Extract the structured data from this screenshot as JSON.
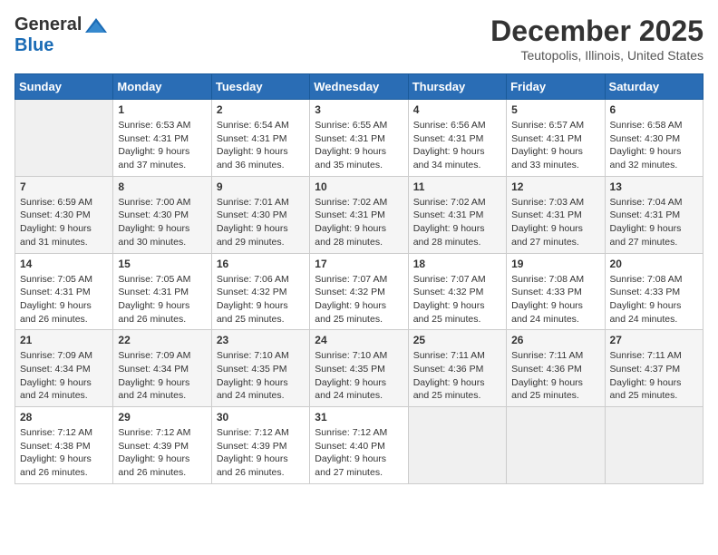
{
  "header": {
    "logo_general": "General",
    "logo_blue": "Blue",
    "month_title": "December 2025",
    "location": "Teutopolis, Illinois, United States"
  },
  "days_of_week": [
    "Sunday",
    "Monday",
    "Tuesday",
    "Wednesday",
    "Thursday",
    "Friday",
    "Saturday"
  ],
  "weeks": [
    [
      {
        "day": "",
        "sunrise": "",
        "sunset": "",
        "daylight": ""
      },
      {
        "day": "1",
        "sunrise": "Sunrise: 6:53 AM",
        "sunset": "Sunset: 4:31 PM",
        "daylight": "Daylight: 9 hours and 37 minutes."
      },
      {
        "day": "2",
        "sunrise": "Sunrise: 6:54 AM",
        "sunset": "Sunset: 4:31 PM",
        "daylight": "Daylight: 9 hours and 36 minutes."
      },
      {
        "day": "3",
        "sunrise": "Sunrise: 6:55 AM",
        "sunset": "Sunset: 4:31 PM",
        "daylight": "Daylight: 9 hours and 35 minutes."
      },
      {
        "day": "4",
        "sunrise": "Sunrise: 6:56 AM",
        "sunset": "Sunset: 4:31 PM",
        "daylight": "Daylight: 9 hours and 34 minutes."
      },
      {
        "day": "5",
        "sunrise": "Sunrise: 6:57 AM",
        "sunset": "Sunset: 4:31 PM",
        "daylight": "Daylight: 9 hours and 33 minutes."
      },
      {
        "day": "6",
        "sunrise": "Sunrise: 6:58 AM",
        "sunset": "Sunset: 4:30 PM",
        "daylight": "Daylight: 9 hours and 32 minutes."
      }
    ],
    [
      {
        "day": "7",
        "sunrise": "Sunrise: 6:59 AM",
        "sunset": "Sunset: 4:30 PM",
        "daylight": "Daylight: 9 hours and 31 minutes."
      },
      {
        "day": "8",
        "sunrise": "Sunrise: 7:00 AM",
        "sunset": "Sunset: 4:30 PM",
        "daylight": "Daylight: 9 hours and 30 minutes."
      },
      {
        "day": "9",
        "sunrise": "Sunrise: 7:01 AM",
        "sunset": "Sunset: 4:30 PM",
        "daylight": "Daylight: 9 hours and 29 minutes."
      },
      {
        "day": "10",
        "sunrise": "Sunrise: 7:02 AM",
        "sunset": "Sunset: 4:31 PM",
        "daylight": "Daylight: 9 hours and 28 minutes."
      },
      {
        "day": "11",
        "sunrise": "Sunrise: 7:02 AM",
        "sunset": "Sunset: 4:31 PM",
        "daylight": "Daylight: 9 hours and 28 minutes."
      },
      {
        "day": "12",
        "sunrise": "Sunrise: 7:03 AM",
        "sunset": "Sunset: 4:31 PM",
        "daylight": "Daylight: 9 hours and 27 minutes."
      },
      {
        "day": "13",
        "sunrise": "Sunrise: 7:04 AM",
        "sunset": "Sunset: 4:31 PM",
        "daylight": "Daylight: 9 hours and 27 minutes."
      }
    ],
    [
      {
        "day": "14",
        "sunrise": "Sunrise: 7:05 AM",
        "sunset": "Sunset: 4:31 PM",
        "daylight": "Daylight: 9 hours and 26 minutes."
      },
      {
        "day": "15",
        "sunrise": "Sunrise: 7:05 AM",
        "sunset": "Sunset: 4:31 PM",
        "daylight": "Daylight: 9 hours and 26 minutes."
      },
      {
        "day": "16",
        "sunrise": "Sunrise: 7:06 AM",
        "sunset": "Sunset: 4:32 PM",
        "daylight": "Daylight: 9 hours and 25 minutes."
      },
      {
        "day": "17",
        "sunrise": "Sunrise: 7:07 AM",
        "sunset": "Sunset: 4:32 PM",
        "daylight": "Daylight: 9 hours and 25 minutes."
      },
      {
        "day": "18",
        "sunrise": "Sunrise: 7:07 AM",
        "sunset": "Sunset: 4:32 PM",
        "daylight": "Daylight: 9 hours and 25 minutes."
      },
      {
        "day": "19",
        "sunrise": "Sunrise: 7:08 AM",
        "sunset": "Sunset: 4:33 PM",
        "daylight": "Daylight: 9 hours and 24 minutes."
      },
      {
        "day": "20",
        "sunrise": "Sunrise: 7:08 AM",
        "sunset": "Sunset: 4:33 PM",
        "daylight": "Daylight: 9 hours and 24 minutes."
      }
    ],
    [
      {
        "day": "21",
        "sunrise": "Sunrise: 7:09 AM",
        "sunset": "Sunset: 4:34 PM",
        "daylight": "Daylight: 9 hours and 24 minutes."
      },
      {
        "day": "22",
        "sunrise": "Sunrise: 7:09 AM",
        "sunset": "Sunset: 4:34 PM",
        "daylight": "Daylight: 9 hours and 24 minutes."
      },
      {
        "day": "23",
        "sunrise": "Sunrise: 7:10 AM",
        "sunset": "Sunset: 4:35 PM",
        "daylight": "Daylight: 9 hours and 24 minutes."
      },
      {
        "day": "24",
        "sunrise": "Sunrise: 7:10 AM",
        "sunset": "Sunset: 4:35 PM",
        "daylight": "Daylight: 9 hours and 24 minutes."
      },
      {
        "day": "25",
        "sunrise": "Sunrise: 7:11 AM",
        "sunset": "Sunset: 4:36 PM",
        "daylight": "Daylight: 9 hours and 25 minutes."
      },
      {
        "day": "26",
        "sunrise": "Sunrise: 7:11 AM",
        "sunset": "Sunset: 4:36 PM",
        "daylight": "Daylight: 9 hours and 25 minutes."
      },
      {
        "day": "27",
        "sunrise": "Sunrise: 7:11 AM",
        "sunset": "Sunset: 4:37 PM",
        "daylight": "Daylight: 9 hours and 25 minutes."
      }
    ],
    [
      {
        "day": "28",
        "sunrise": "Sunrise: 7:12 AM",
        "sunset": "Sunset: 4:38 PM",
        "daylight": "Daylight: 9 hours and 26 minutes."
      },
      {
        "day": "29",
        "sunrise": "Sunrise: 7:12 AM",
        "sunset": "Sunset: 4:39 PM",
        "daylight": "Daylight: 9 hours and 26 minutes."
      },
      {
        "day": "30",
        "sunrise": "Sunrise: 7:12 AM",
        "sunset": "Sunset: 4:39 PM",
        "daylight": "Daylight: 9 hours and 26 minutes."
      },
      {
        "day": "31",
        "sunrise": "Sunrise: 7:12 AM",
        "sunset": "Sunset: 4:40 PM",
        "daylight": "Daylight: 9 hours and 27 minutes."
      },
      {
        "day": "",
        "sunrise": "",
        "sunset": "",
        "daylight": ""
      },
      {
        "day": "",
        "sunrise": "",
        "sunset": "",
        "daylight": ""
      },
      {
        "day": "",
        "sunrise": "",
        "sunset": "",
        "daylight": ""
      }
    ]
  ]
}
